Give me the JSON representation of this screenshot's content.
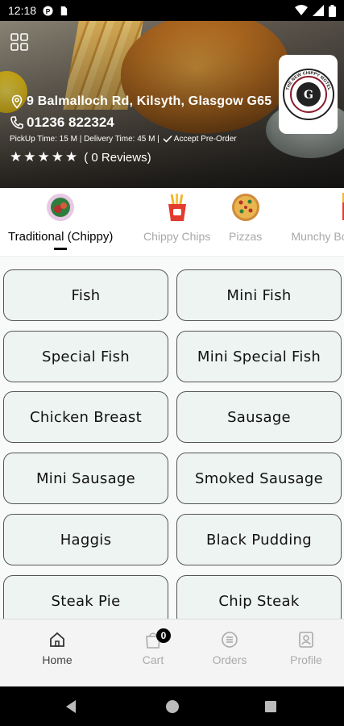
{
  "status_bar": {
    "time": "12:18",
    "icons": [
      "notification-p-icon",
      "sim-card-icon",
      "wifi-icon",
      "cellular-signal-icon",
      "battery-icon"
    ]
  },
  "restaurant": {
    "address": "9 Balmalloch Rd, Kilsyth, Glasgow G65",
    "phone": "01236 822324",
    "timing": "PickUp Time: 15 M | Delivery Time: 45 M |",
    "preorder": "Accept Pre-Order",
    "rating_stars": 5,
    "reviews_text": "( 0 Reviews)",
    "logo_text": "THE NEW CHIPPY MOTEL"
  },
  "categories": [
    {
      "label": "Traditional (Chippy)",
      "icon": "traditional-plate-icon",
      "active": true
    },
    {
      "label": "Chippy Chips",
      "icon": "fries-icon",
      "active": false
    },
    {
      "label": "Pizzas",
      "icon": "pizza-icon",
      "active": false
    },
    {
      "label": "Munchy Box",
      "icon": "munchy-box-icon",
      "active": false
    }
  ],
  "menu_items": [
    "Fish",
    "Mini Fish",
    "Special Fish",
    "Mini Special Fish",
    "Chicken Breast",
    "Sausage",
    "Mini Sausage",
    "Smoked Sausage",
    "Haggis",
    "Black Pudding",
    "Steak Pie",
    "Chip Steak"
  ],
  "bottom_nav": [
    {
      "label": "Home",
      "icon": "home-icon",
      "active": true
    },
    {
      "label": "Cart",
      "icon": "cart-icon",
      "active": false,
      "badge": "0"
    },
    {
      "label": "Orders",
      "icon": "orders-icon",
      "active": false
    },
    {
      "label": "Profile",
      "icon": "profile-icon",
      "active": false
    }
  ],
  "colors": {
    "menu_button_bg": "#eef4f2",
    "menu_button_border": "#555555",
    "active_text": "#000000",
    "inactive_text": "#a8a8a8"
  }
}
